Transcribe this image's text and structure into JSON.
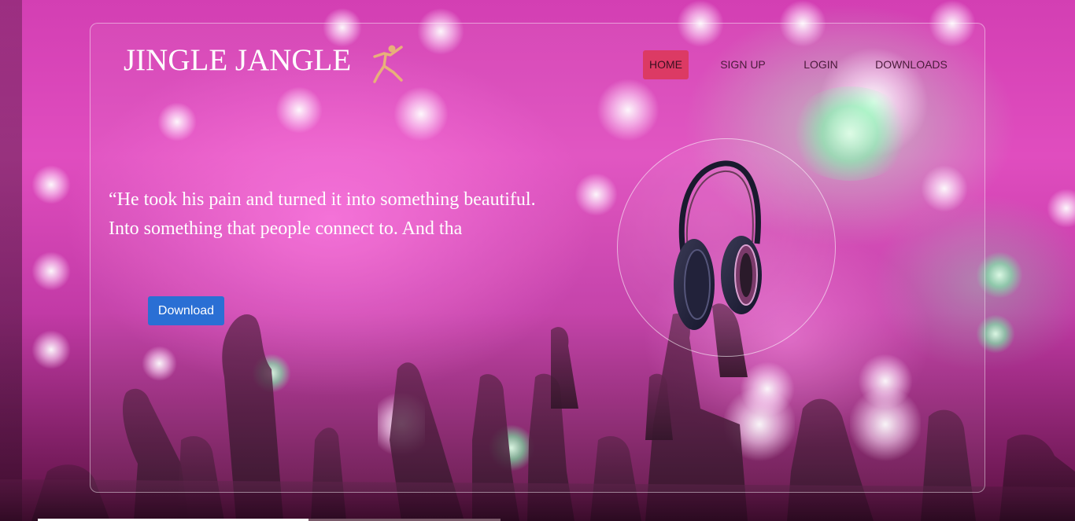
{
  "brand": {
    "name": "JINGLE JANGLE",
    "logo_icon": "dancer-icon"
  },
  "nav": {
    "items": [
      {
        "label": "HOME",
        "active": true
      },
      {
        "label": "SIGN UP",
        "active": false
      },
      {
        "label": "LOGIN",
        "active": false
      },
      {
        "label": "DOWNLOADS",
        "active": false
      }
    ]
  },
  "hero": {
    "quote": "“He took his pain and turned it into something beautiful. Into something that people connect to. And tha",
    "download_label": "Download",
    "image_icon": "headphones-icon"
  },
  "colors": {
    "active_nav": "#dc3a64",
    "download_button": "#2a6fd4",
    "background_accent": "#e04dbf"
  }
}
